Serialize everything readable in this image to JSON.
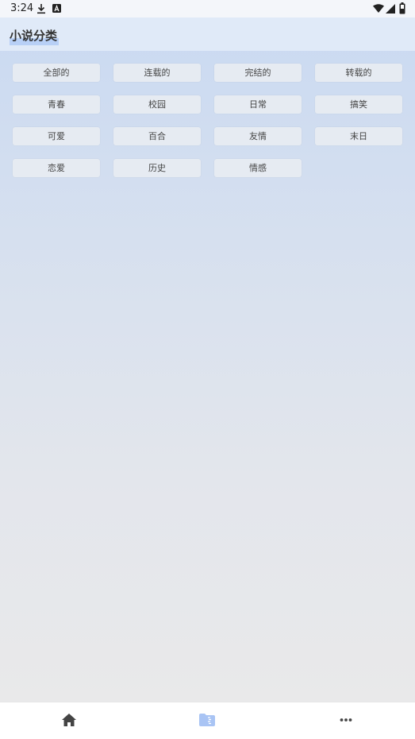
{
  "status_bar": {
    "time": "3:24"
  },
  "app_bar": {
    "title": "小说分类"
  },
  "categories": [
    "全部的",
    "连载的",
    "完结的",
    "转载的",
    "青春",
    "校园",
    "日常",
    "搞笑",
    "可爱",
    "百合",
    "友情",
    "末日",
    "恋爱",
    "历史",
    "情感"
  ],
  "bottom_nav": {
    "items": [
      {
        "icon": "home-icon",
        "active": false
      },
      {
        "icon": "category-folder-icon",
        "active": true
      },
      {
        "icon": "more-icon",
        "active": false
      }
    ],
    "active_color": "#a9c4f4",
    "inactive_color": "#444444"
  }
}
